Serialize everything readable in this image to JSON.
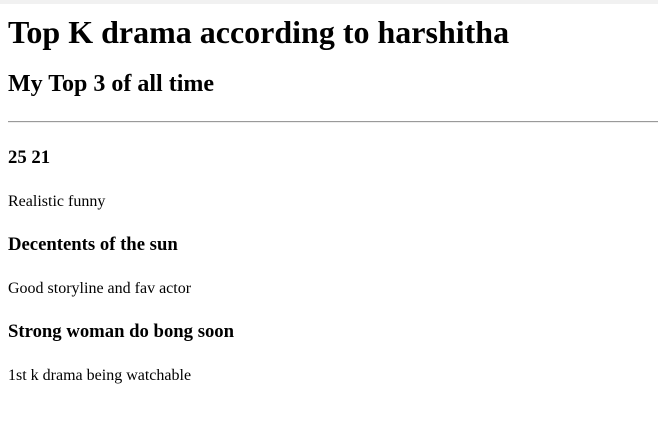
{
  "page": {
    "title": "Top K drama according to harshitha",
    "subtitle": "My Top 3 of all time"
  },
  "dramas": [
    {
      "title": "25 21",
      "description": "Realistic funny"
    },
    {
      "title": "Decentents of the sun",
      "description": "Good storyline and fav actor"
    },
    {
      "title": "Strong woman do bong soon",
      "description": "1st k drama being watchable"
    }
  ]
}
